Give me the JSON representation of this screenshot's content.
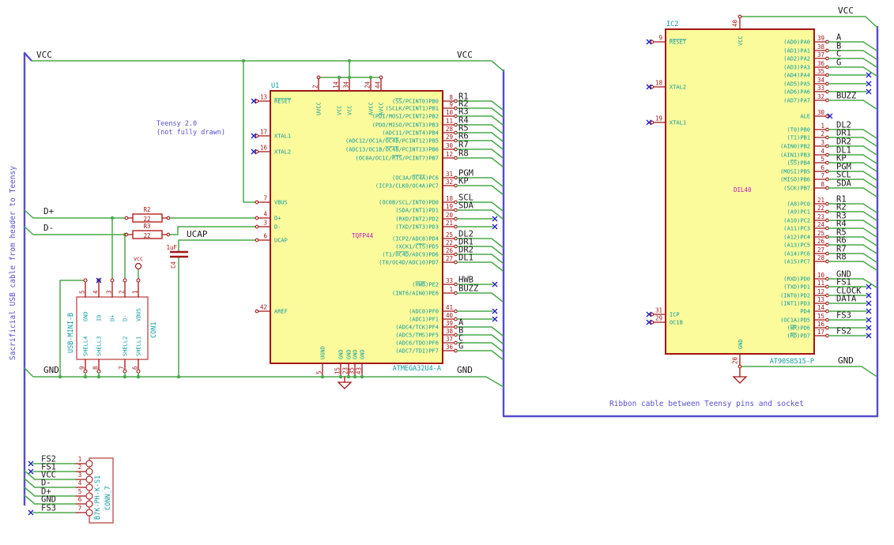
{
  "colors": {
    "wire_green": "#4aa84a",
    "pin_red": "#a41414",
    "component_fill": "#fbfb9c",
    "pin_name_cyan": "#0e9c9c",
    "package_magenta": "#bf12bf",
    "note_blue": "#5a50cc",
    "cable_blue": "#554ccc",
    "net_text": "#1a1a1a",
    "no_connect_blue": "#1c1cc8"
  },
  "notes": {
    "teensy_line1": "Teensy 2.0",
    "teensy_line2": "(not fully drawn)",
    "left_cable": "Sacrificial USB cable from header to Teensy",
    "right_cable": "Ribbon cable between Teensy pins and socket"
  },
  "net_labels": {
    "vcc": "VCC",
    "gnd": "GND",
    "dplus": "D+",
    "dminus": "D-",
    "ucap": "UCAP"
  },
  "power_flag": {
    "label": "VCC"
  },
  "resistors": [
    {
      "ref": "R2",
      "value": "22"
    },
    {
      "ref": "R3",
      "value": "22"
    }
  ],
  "capacitor": {
    "ref": "C4",
    "value": "1uF"
  },
  "u1": {
    "ref": "U1",
    "part": "ATMEGA32U4-A",
    "package": "TQFP44",
    "left_pins": [
      {
        "num": "13",
        "name": "~RESET~",
        "conn": "nc"
      },
      {
        "num": "17",
        "name": "XTAL1",
        "conn": "nc"
      },
      {
        "num": "16",
        "name": "XTAL2",
        "conn": "nc"
      },
      {
        "num": "7",
        "name": "VBUS",
        "conn": "wire"
      },
      {
        "num": "4",
        "name": "D+",
        "conn": "wire"
      },
      {
        "num": "3",
        "name": "D-",
        "conn": "wire"
      },
      {
        "num": "6",
        "name": "UCAP",
        "conn": "wire"
      },
      {
        "num": "42",
        "name": "AREF",
        "conn": "open"
      }
    ],
    "top_pins": [
      {
        "num": "2",
        "name": "UVCC"
      },
      {
        "num": "14",
        "name": "VCC"
      },
      {
        "num": "34",
        "name": "VCC"
      },
      {
        "num": "24",
        "name": "AVCC"
      },
      {
        "num": "44",
        "name": "AVCC"
      }
    ],
    "bottom_pins": [
      {
        "num": "5",
        "name": "UGND"
      },
      {
        "num": "15",
        "name": "GND"
      },
      {
        "num": "23",
        "name": "GND"
      },
      {
        "num": "35",
        "name": "GND"
      },
      {
        "num": "43",
        "name": "GND"
      }
    ],
    "right_banks": [
      [
        {
          "num": "8",
          "name": "(~SS~/PCINT0)PB0",
          "net": "R1",
          "conn": "cable"
        },
        {
          "num": "9",
          "name": "(SCLK/PCINT1)PB1",
          "net": "R2",
          "conn": "cable"
        },
        {
          "num": "10",
          "name": "(PDI/MOSI/PCINT2)PB2",
          "net": "R3",
          "conn": "cable"
        },
        {
          "num": "11",
          "name": "(PDO/MISO/PCINT3)PB3",
          "net": "R4",
          "conn": "cable"
        },
        {
          "num": "28",
          "name": "(ADC11/PCINT4)PB4",
          "net": "R5",
          "conn": "cable"
        },
        {
          "num": "29",
          "name": "(ADC12/OC1A/~OC4B~/PCINT12)PB5",
          "net": "R6",
          "conn": "cable"
        },
        {
          "num": "30",
          "name": "(ADC13/OC1B/~OC4B~/PCINT13)PB6",
          "net": "R7",
          "conn": "cable"
        },
        {
          "num": "12",
          "name": "(OC0A/OC1C/~RTS~/PCINT7)PB7",
          "net": "R8",
          "conn": "cable"
        }
      ],
      [
        {
          "num": "31",
          "name": "(OC3A/~OC4A~)PC6",
          "net": "PGM",
          "conn": "cable"
        },
        {
          "num": "32",
          "name": "(ICP3/CLK0/OC4A)PC7",
          "net": "KP",
          "conn": "cable"
        }
      ],
      [
        {
          "num": "18",
          "name": "(OC0B/SCL/INT0)PD0",
          "net": "SCL",
          "conn": "cable"
        },
        {
          "num": "19",
          "name": "(SDA/INT1)PD1",
          "net": "SDA",
          "conn": "cable"
        },
        {
          "num": "20",
          "name": "(RXD/INT2)PD2",
          "net": "",
          "conn": "nc"
        },
        {
          "num": "21",
          "name": "(TXD/INT3)PD3",
          "net": "",
          "conn": "nc"
        }
      ],
      [
        {
          "num": "25",
          "name": "(ICP2/ADC8)PD4",
          "net": "DL2",
          "conn": "cable"
        },
        {
          "num": "22",
          "name": "(XCK1/~CTS~)PD5",
          "net": "DR1",
          "conn": "cable"
        },
        {
          "num": "26",
          "name": "(T1/~OC4D~/ADC9)PD6",
          "net": "DR2",
          "conn": "cable"
        },
        {
          "num": "27",
          "name": "(T0/OC4D/ADC10)PD7",
          "net": "DL1",
          "conn": "cable"
        }
      ],
      [
        {
          "num": "33",
          "name": "(~HWB~)PE2",
          "net": "HWB",
          "conn": "nc_label"
        },
        {
          "num": "1",
          "name": "(INT6/AIN0)PE6",
          "net": "BUZZ",
          "conn": "cable"
        }
      ],
      [
        {
          "num": "41",
          "name": "(ADC0)PF0",
          "net": "",
          "conn": "nc"
        },
        {
          "num": "40",
          "name": "(ADC1)PF1",
          "net": "",
          "conn": "nc"
        },
        {
          "num": "39",
          "name": "(ADC4/TCK)PF4",
          "net": "A",
          "conn": "cable"
        },
        {
          "num": "38",
          "name": "(ADC5/TMS)PF5",
          "net": "B",
          "conn": "cable"
        },
        {
          "num": "37",
          "name": "(ADC6/TDO)PF6",
          "net": "C",
          "conn": "cable"
        },
        {
          "num": "36",
          "name": "(ADC7/TDI)PF7",
          "net": "G",
          "conn": "cable"
        }
      ]
    ]
  },
  "ic2": {
    "ref": "IC2",
    "part": "AT90S8515-P",
    "package": "DIL40",
    "power_top": {
      "num": "40",
      "name": "VCC",
      "net": "VCC"
    },
    "power_bottom": {
      "num": "20",
      "name": "GND",
      "net": "GND"
    },
    "left_pins": [
      {
        "num": "9",
        "name": "~RESET~",
        "conn": "nc"
      },
      {
        "num": "18",
        "name": "XTAL2",
        "conn": "nc"
      },
      {
        "num": "19",
        "name": "XTAL1",
        "conn": "nc"
      },
      {
        "num": "31",
        "name": "ICP",
        "conn": "nc"
      },
      {
        "num": "29",
        "name": "OC1B",
        "conn": "nc"
      }
    ],
    "right_banks": [
      [
        {
          "num": "39",
          "name": "(AD0)PA0",
          "net": "A",
          "conn": "cable"
        },
        {
          "num": "38",
          "name": "(AD1)PA1",
          "net": "B",
          "conn": "cable"
        },
        {
          "num": "37",
          "name": "(AD2)PA2",
          "net": "C",
          "conn": "cable"
        },
        {
          "num": "36",
          "name": "(AD3)PA3",
          "net": "G",
          "conn": "cable"
        },
        {
          "num": "35",
          "name": "(AD4)PA4",
          "net": "",
          "conn": "nc"
        },
        {
          "num": "34",
          "name": "(AD5)PA5",
          "net": "",
          "conn": "nc"
        },
        {
          "num": "33",
          "name": "(AD6)PA6",
          "net": "",
          "conn": "nc"
        },
        {
          "num": "32",
          "name": "(AD7)PA7",
          "net": "BUZZ",
          "conn": "cable"
        }
      ],
      [
        {
          "num": "30",
          "name": "ALE",
          "net": "",
          "conn": "nc_pin"
        }
      ],
      [
        {
          "num": "1",
          "name": "(T0)PB0",
          "net": "DL2",
          "conn": "cable"
        },
        {
          "num": "2",
          "name": "(T1)PB1",
          "net": "DR1",
          "conn": "cable"
        },
        {
          "num": "3",
          "name": "(AIN0)PB2",
          "net": "DR2",
          "conn": "cable"
        },
        {
          "num": "4",
          "name": "(AIN1)PB3",
          "net": "DL1",
          "conn": "cable"
        },
        {
          "num": "5",
          "name": "(~SS~)PB4",
          "net": "KP",
          "conn": "cable"
        },
        {
          "num": "6",
          "name": "(MOSI)PB5",
          "net": "PGM",
          "conn": "cable"
        },
        {
          "num": "7",
          "name": "(MISO)PB6",
          "net": "SCL",
          "conn": "cable"
        },
        {
          "num": "8",
          "name": "(SCK)PB7",
          "net": "SDA",
          "conn": "cable"
        }
      ],
      [
        {
          "num": "21",
          "name": "(A8)PC0",
          "net": "R1",
          "conn": "cable"
        },
        {
          "num": "22",
          "name": "(A9)PC1",
          "net": "R2",
          "conn": "cable"
        },
        {
          "num": "23",
          "name": "(A10)PC2",
          "net": "R3",
          "conn": "cable"
        },
        {
          "num": "24",
          "name": "(A11)PC3",
          "net": "R4",
          "conn": "cable"
        },
        {
          "num": "25",
          "name": "(A12)PC4",
          "net": "R5",
          "conn": "cable"
        },
        {
          "num": "26",
          "name": "(A13)PC5",
          "net": "R6",
          "conn": "cable"
        },
        {
          "num": "27",
          "name": "(A14)PC6",
          "net": "R7",
          "conn": "cable"
        },
        {
          "num": "28",
          "name": "(A15)PC7",
          "net": "R8",
          "conn": "cable"
        }
      ],
      [
        {
          "num": "10",
          "name": "(RXD)PD0",
          "net": "GND",
          "conn": "cable"
        },
        {
          "num": "11",
          "name": "(TXD)PD1",
          "net": "FS1",
          "conn": "nc_label"
        },
        {
          "num": "12",
          "name": "(INT0)PD2",
          "net": "CLOCK",
          "conn": "nc_label"
        },
        {
          "num": "13",
          "name": "(INT1)PD3",
          "net": "DATA",
          "conn": "nc_label"
        },
        {
          "num": "14",
          "name": "PD4",
          "net": "",
          "conn": "nc"
        },
        {
          "num": "15",
          "name": "(OC1A)PD5",
          "net": "FS3",
          "conn": "nc_label"
        },
        {
          "num": "16",
          "name": "(~WR~)PD6",
          "net": "",
          "conn": "nc"
        },
        {
          "num": "17",
          "name": "(~RD~)PD7",
          "net": "FS2",
          "conn": "nc_label"
        }
      ]
    ]
  },
  "con1": {
    "ref": "CON1",
    "part": "USB-MINI-B",
    "top_pins": [
      {
        "num": "5",
        "name": "GND"
      },
      {
        "num": "4",
        "name": "ID",
        "nc": true
      },
      {
        "num": "3",
        "name": "D+"
      },
      {
        "num": "2",
        "name": "D-"
      },
      {
        "num": "1",
        "name": "VBUS"
      }
    ],
    "bottom_pins": [
      {
        "num": "9",
        "name": "SHELL4"
      },
      {
        "num": "8",
        "name": "SHELL3"
      },
      {
        "num": "7",
        "name": "SHELL2"
      },
      {
        "num": "6",
        "name": "SHELL1"
      }
    ]
  },
  "conn7": {
    "ref": "CONN_7",
    "part": "B7K-PH-K-S1",
    "pins": [
      {
        "num": "1",
        "net": "FS2",
        "conn": "nc"
      },
      {
        "num": "2",
        "net": "FS1",
        "conn": "nc"
      },
      {
        "num": "3",
        "net": "VCC",
        "conn": "cable"
      },
      {
        "num": "4",
        "net": "D-",
        "conn": "cable"
      },
      {
        "num": "5",
        "net": "D+",
        "conn": "cable"
      },
      {
        "num": "6",
        "net": "GND",
        "conn": "cable"
      },
      {
        "num": "7",
        "net": "FS3",
        "conn": "nc"
      }
    ]
  }
}
